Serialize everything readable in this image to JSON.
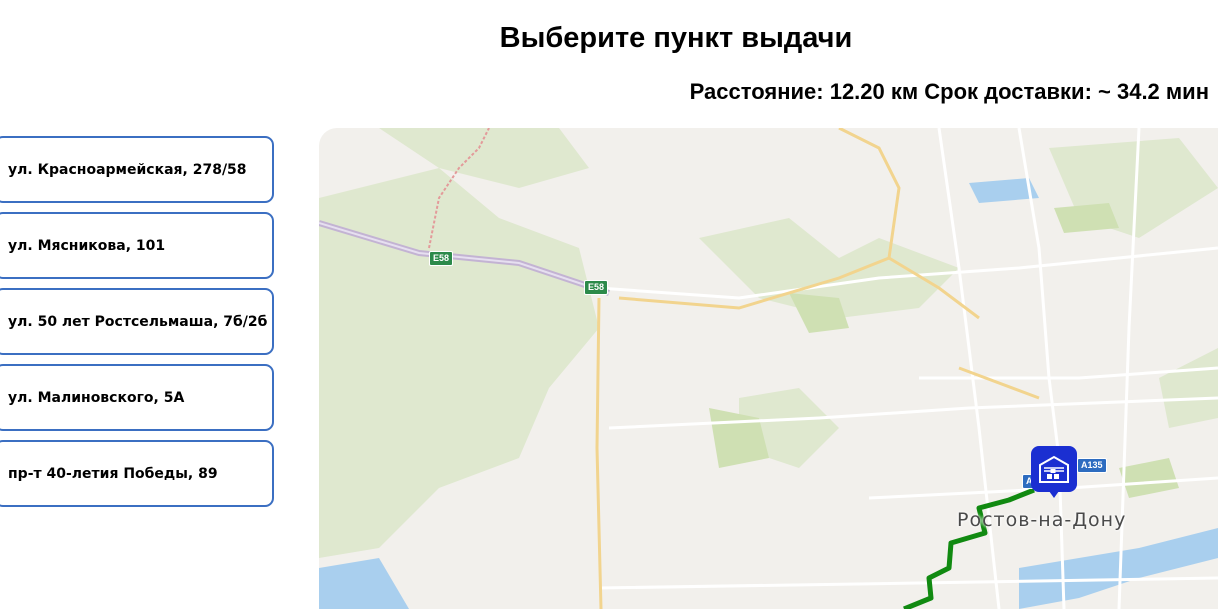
{
  "header": {
    "title": "Выберите пункт выдачи",
    "distance_line": "Расстояние: 12.20 км Срок доставки: ~ 34.2 мин"
  },
  "pickup_points": [
    {
      "label": "ул. Красноармейская, 278/58"
    },
    {
      "label": "ул. Мясникова, 101"
    },
    {
      "label": "ул. 50 лет Ростсельмаша, 7б/2б"
    },
    {
      "label": "ул. Малиновского, 5А"
    },
    {
      "label": "пр-т 40-летия Победы, 89"
    }
  ],
  "map": {
    "city_label": "Ростов-на-Дону",
    "road_badges": [
      "E58",
      "E58",
      "A135",
      "A"
    ],
    "marker_icon": "warehouse-icon",
    "route_color": "#118a11"
  }
}
